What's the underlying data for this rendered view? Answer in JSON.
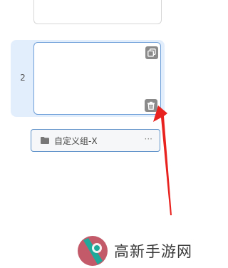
{
  "row": {
    "number": "2"
  },
  "icons": {
    "copy": "copy-icon",
    "delete": "trash-icon",
    "folder": "folder-icon",
    "more": "more-icon"
  },
  "group": {
    "label": "自定义组-X",
    "more": "···"
  },
  "watermark": {
    "text": "高新手游网"
  },
  "colors": {
    "row_highlight": "#e3eefc",
    "box_border": "#6f9fd8",
    "icon_bg": "#8a8a8a",
    "arrow": "#e8231f",
    "logo_teal": "#1fa99a",
    "logo_pink": "#c25a6a"
  }
}
